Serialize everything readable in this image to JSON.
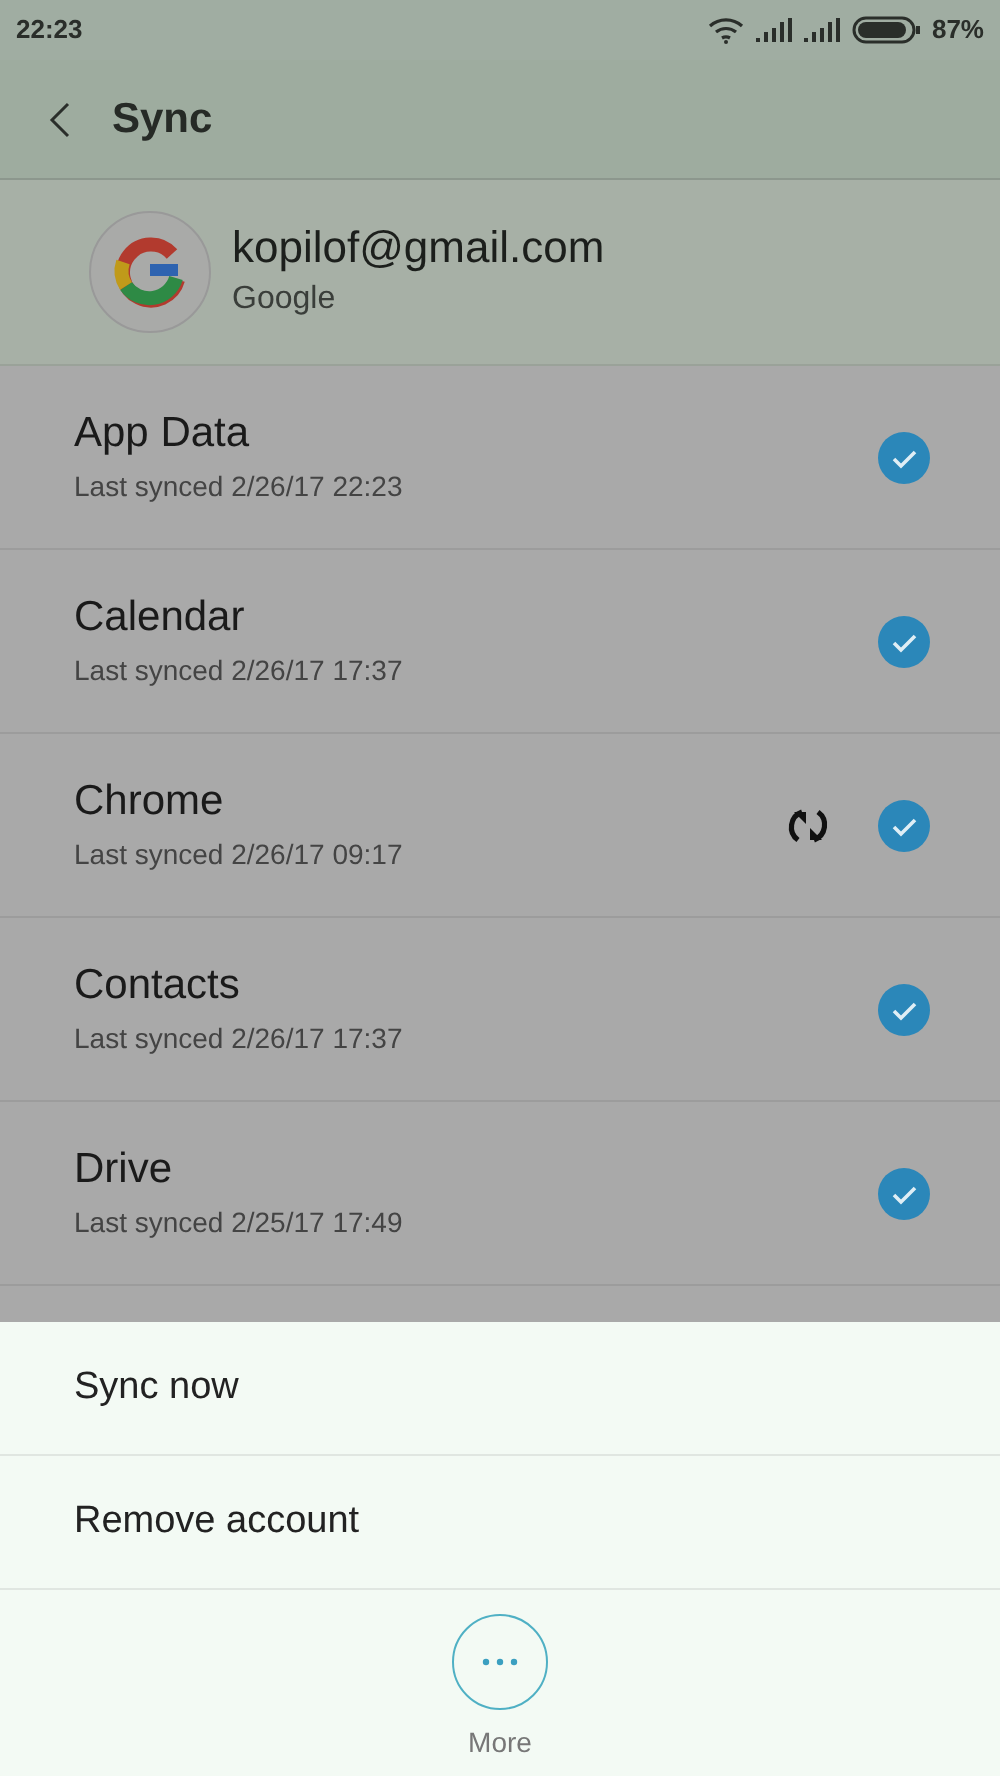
{
  "status_bar": {
    "time": "22:23",
    "battery": "87%"
  },
  "header": {
    "title": "Sync"
  },
  "account": {
    "email": "kopilof@gmail.com",
    "provider": "Google"
  },
  "sync_items": [
    {
      "name": "App Data",
      "last_synced": "Last synced 2/26/17 22:23",
      "checked": true,
      "syncing": false
    },
    {
      "name": "Calendar",
      "last_synced": "Last synced 2/26/17 17:37",
      "checked": true,
      "syncing": false
    },
    {
      "name": "Chrome",
      "last_synced": "Last synced 2/26/17 09:17",
      "checked": true,
      "syncing": true
    },
    {
      "name": "Contacts",
      "last_synced": "Last synced 2/26/17 17:37",
      "checked": true,
      "syncing": false
    },
    {
      "name": "Drive",
      "last_synced": "Last synced 2/25/17 17:49",
      "checked": true,
      "syncing": false
    }
  ],
  "menu": {
    "items": [
      "Sync now",
      "Remove account"
    ],
    "more_label": "More"
  }
}
